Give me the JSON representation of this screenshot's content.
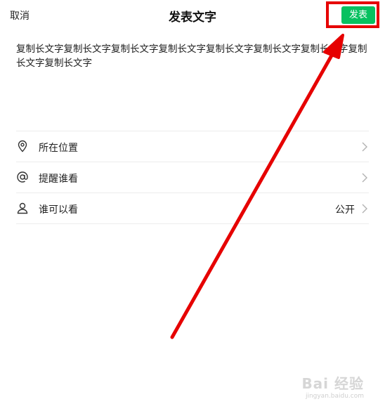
{
  "header": {
    "cancel_label": "取消",
    "title": "发表文字",
    "publish_label": "发表"
  },
  "post": {
    "text": "复制长文字复制长文字复制长文字复制长文字复制长文字复制长文字复制长文字复制长文字复制长文字"
  },
  "options": [
    {
      "icon": "location-pin-icon",
      "label": "所在位置",
      "value": ""
    },
    {
      "icon": "at-sign-icon",
      "label": "提醒谁看",
      "value": ""
    },
    {
      "icon": "person-icon",
      "label": "谁可以看",
      "value": "公开"
    }
  ],
  "annotation": {
    "highlight_color": "#e60000"
  },
  "watermark": {
    "main": "Bai 经验",
    "sub": "jingyan.baidu.com"
  },
  "colors": {
    "accent": "#07c160"
  }
}
